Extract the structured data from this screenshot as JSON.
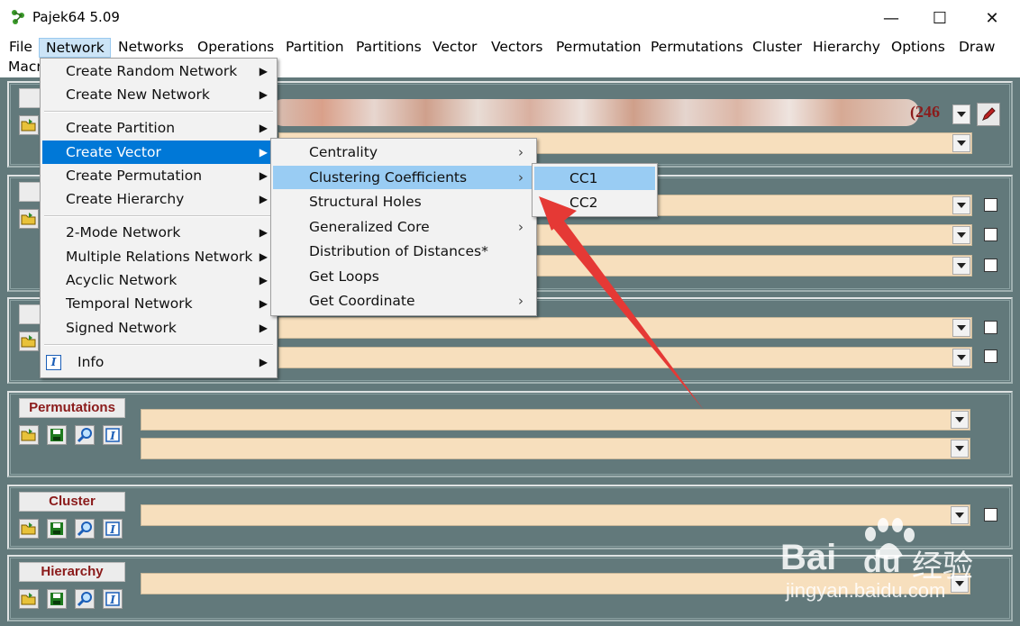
{
  "window": {
    "title": "Pajek64 5.09",
    "minimize_glyph": "—",
    "maximize_glyph": "☐",
    "close_glyph": "✕"
  },
  "menubar": {
    "items": [
      {
        "label": "File"
      },
      {
        "label": "Network"
      },
      {
        "label": "Networks"
      },
      {
        "label": "Operations"
      },
      {
        "label": "Partition"
      },
      {
        "label": "Partitions"
      },
      {
        "label": "Vector"
      },
      {
        "label": "Vectors"
      },
      {
        "label": "Permutation"
      },
      {
        "label": "Permutations"
      },
      {
        "label": "Cluster"
      },
      {
        "label": "Hierarchy"
      },
      {
        "label": "Options"
      },
      {
        "label": "Draw"
      }
    ],
    "second_row_label": "Macr"
  },
  "network_menu": {
    "items": [
      "Create Random Network",
      "Create New Network",
      "Create Partition",
      "Create Vector",
      "Create Permutation",
      "Create Hierarchy",
      "2-Mode Network",
      "Multiple Relations Network",
      "Acyclic Network",
      "Temporal Network",
      "Signed Network",
      "Info"
    ]
  },
  "vector_submenu": {
    "items": [
      "Centrality",
      "Clustering Coefficients",
      "Structural Holes",
      "Generalized Core",
      "Distribution of Distances*",
      "Get Loops",
      "Get Coordinate"
    ]
  },
  "cc_submenu": {
    "items": [
      "CC1",
      "CC2"
    ]
  },
  "panels": {
    "network_count": "(246",
    "permutations_label": "Permutations",
    "cluster_label": "Cluster",
    "hierarchy_label": "Hierarchy"
  },
  "watermark": {
    "brand": "Bai",
    "brand2": "du",
    "cn": "经验",
    "url": "jingyan.baidu.com"
  },
  "colors": {
    "background": "#62797b",
    "combo": "#f7dfbd",
    "label_text": "#8b1b1b",
    "highlight": "#0078d7",
    "highlight_light": "#99ccf3",
    "arrow": "#e53935"
  },
  "icons": [
    "open-folder-icon",
    "save-icon",
    "view-icon",
    "info-icon",
    "edit-pencil-icon"
  ]
}
